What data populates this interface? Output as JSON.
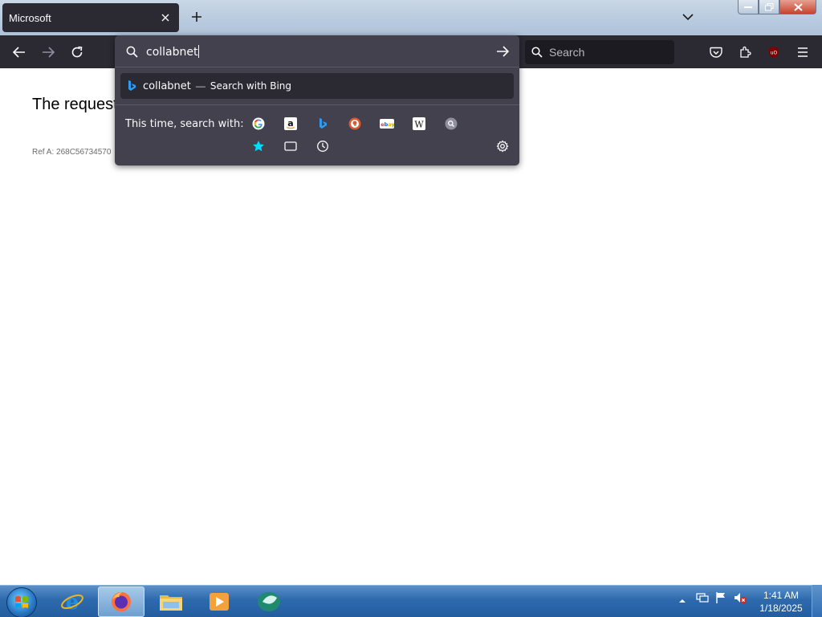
{
  "browser": {
    "tab": {
      "title": "Microsoft"
    },
    "toolbar": {
      "search_placeholder": "Search"
    }
  },
  "urlbar": {
    "typed_text": "collabnet",
    "suggestion": {
      "term": "collabnet",
      "separator": "—",
      "action": "Search with Bing"
    },
    "one_off_label": "This time, search with:",
    "engines": [
      "google-icon",
      "amazon-icon",
      "bing-icon",
      "duckduckgo-icon",
      "ebay-icon",
      "wikipedia-icon",
      "search-engine-icon"
    ],
    "modes": [
      "bookmarks-icon",
      "tabs-icon",
      "history-icon"
    ]
  },
  "page": {
    "title": "The request",
    "ref": "Ref A: 268C56734570"
  },
  "taskbar": {
    "apps": [
      "internet-explorer-icon",
      "firefox-icon",
      "file-explorer-icon",
      "media-player-icon",
      "app-icon"
    ],
    "active_app": "firefox-icon",
    "clock": {
      "time": "1:41 AM",
      "date": "1/18/2025"
    }
  },
  "colors": {
    "toolbar_bg": "#2b2a33",
    "panel_bg": "#42414d",
    "taskbar": "#2d6aad"
  }
}
